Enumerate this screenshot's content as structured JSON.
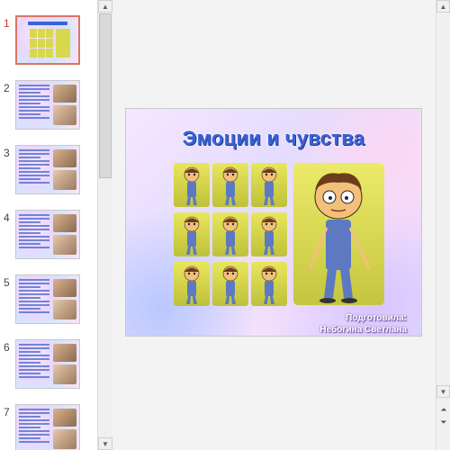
{
  "slides_panel": {
    "thumbnails": [
      {
        "number": "1",
        "selected": true,
        "kind": "title"
      },
      {
        "number": "2",
        "selected": false,
        "kind": "text-image"
      },
      {
        "number": "3",
        "selected": false,
        "kind": "text-grid"
      },
      {
        "number": "4",
        "selected": false,
        "kind": "text-image"
      },
      {
        "number": "5",
        "selected": false,
        "kind": "text-image"
      },
      {
        "number": "6",
        "selected": false,
        "kind": "text-image"
      },
      {
        "number": "7",
        "selected": false,
        "kind": "text-image"
      }
    ]
  },
  "slide": {
    "title": "Эмоции и чувства",
    "credit_line1": "Подготовила:",
    "credit_line2": "Небогина Светлана",
    "grid_rows": 3,
    "grid_cols": 3
  },
  "scrollbar": {
    "up_icon": "triangle-up-icon",
    "down_icon": "triangle-down-icon",
    "prev_slide_icon": "double-chevron-up-icon",
    "next_slide_icon": "double-chevron-down-icon"
  },
  "colors": {
    "title_blue": "#3b63d6",
    "selection_border": "#e07460",
    "tile_yellow": "#d8d84c"
  }
}
